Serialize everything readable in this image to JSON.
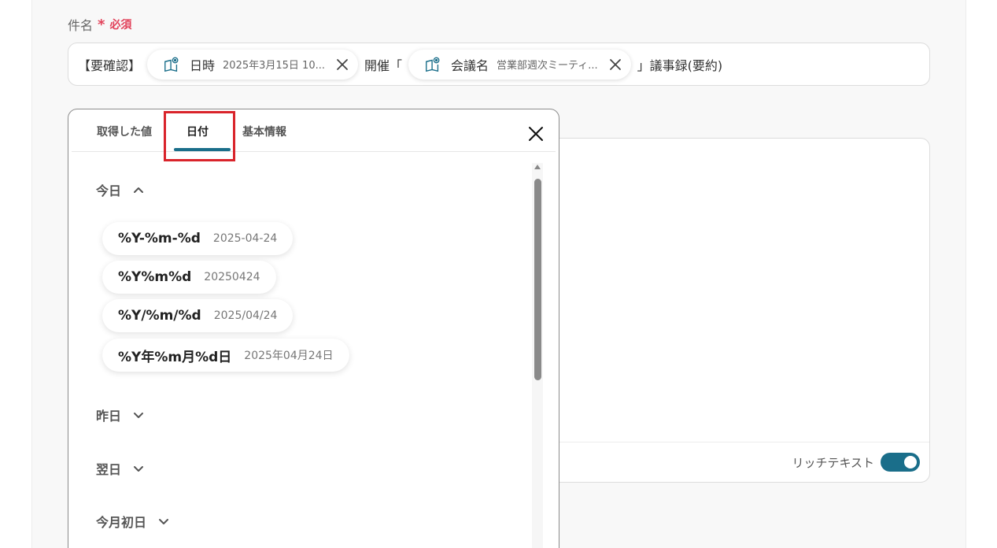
{
  "field": {
    "label": "件名",
    "required_mark": "*",
    "required_text": "必須"
  },
  "subject": {
    "prefix": "【要確認】",
    "chip1": {
      "key": "日時",
      "value": "2025年3月15日 10..."
    },
    "middle": "開催「",
    "chip2": {
      "key": "会議名",
      "value": "営業部週次ミーティ..."
    },
    "suffix": "」議事録(要約)"
  },
  "popup": {
    "tabs": [
      "取得した値",
      "日付",
      "基本情報"
    ],
    "active_tab": "日付",
    "sections": {
      "today": "今日",
      "yesterday": "昨日",
      "tomorrow": "翌日",
      "month_first": "今月初日"
    },
    "options": [
      {
        "format": "%Y-%m-%d",
        "example": "2025-04-24"
      },
      {
        "format": "%Y%m%d",
        "example": "20250424"
      },
      {
        "format": "%Y/%m/%d",
        "example": "2025/04/24"
      },
      {
        "format": "%Y年%m月%d日",
        "example": "2025年04月24日"
      }
    ]
  },
  "editor": {
    "rich_text_label": "リッチテキスト",
    "rich_text_on": true
  },
  "colors": {
    "accent": "#1a6e8a",
    "required": "#e2425a",
    "highlight": "#d9242b"
  }
}
